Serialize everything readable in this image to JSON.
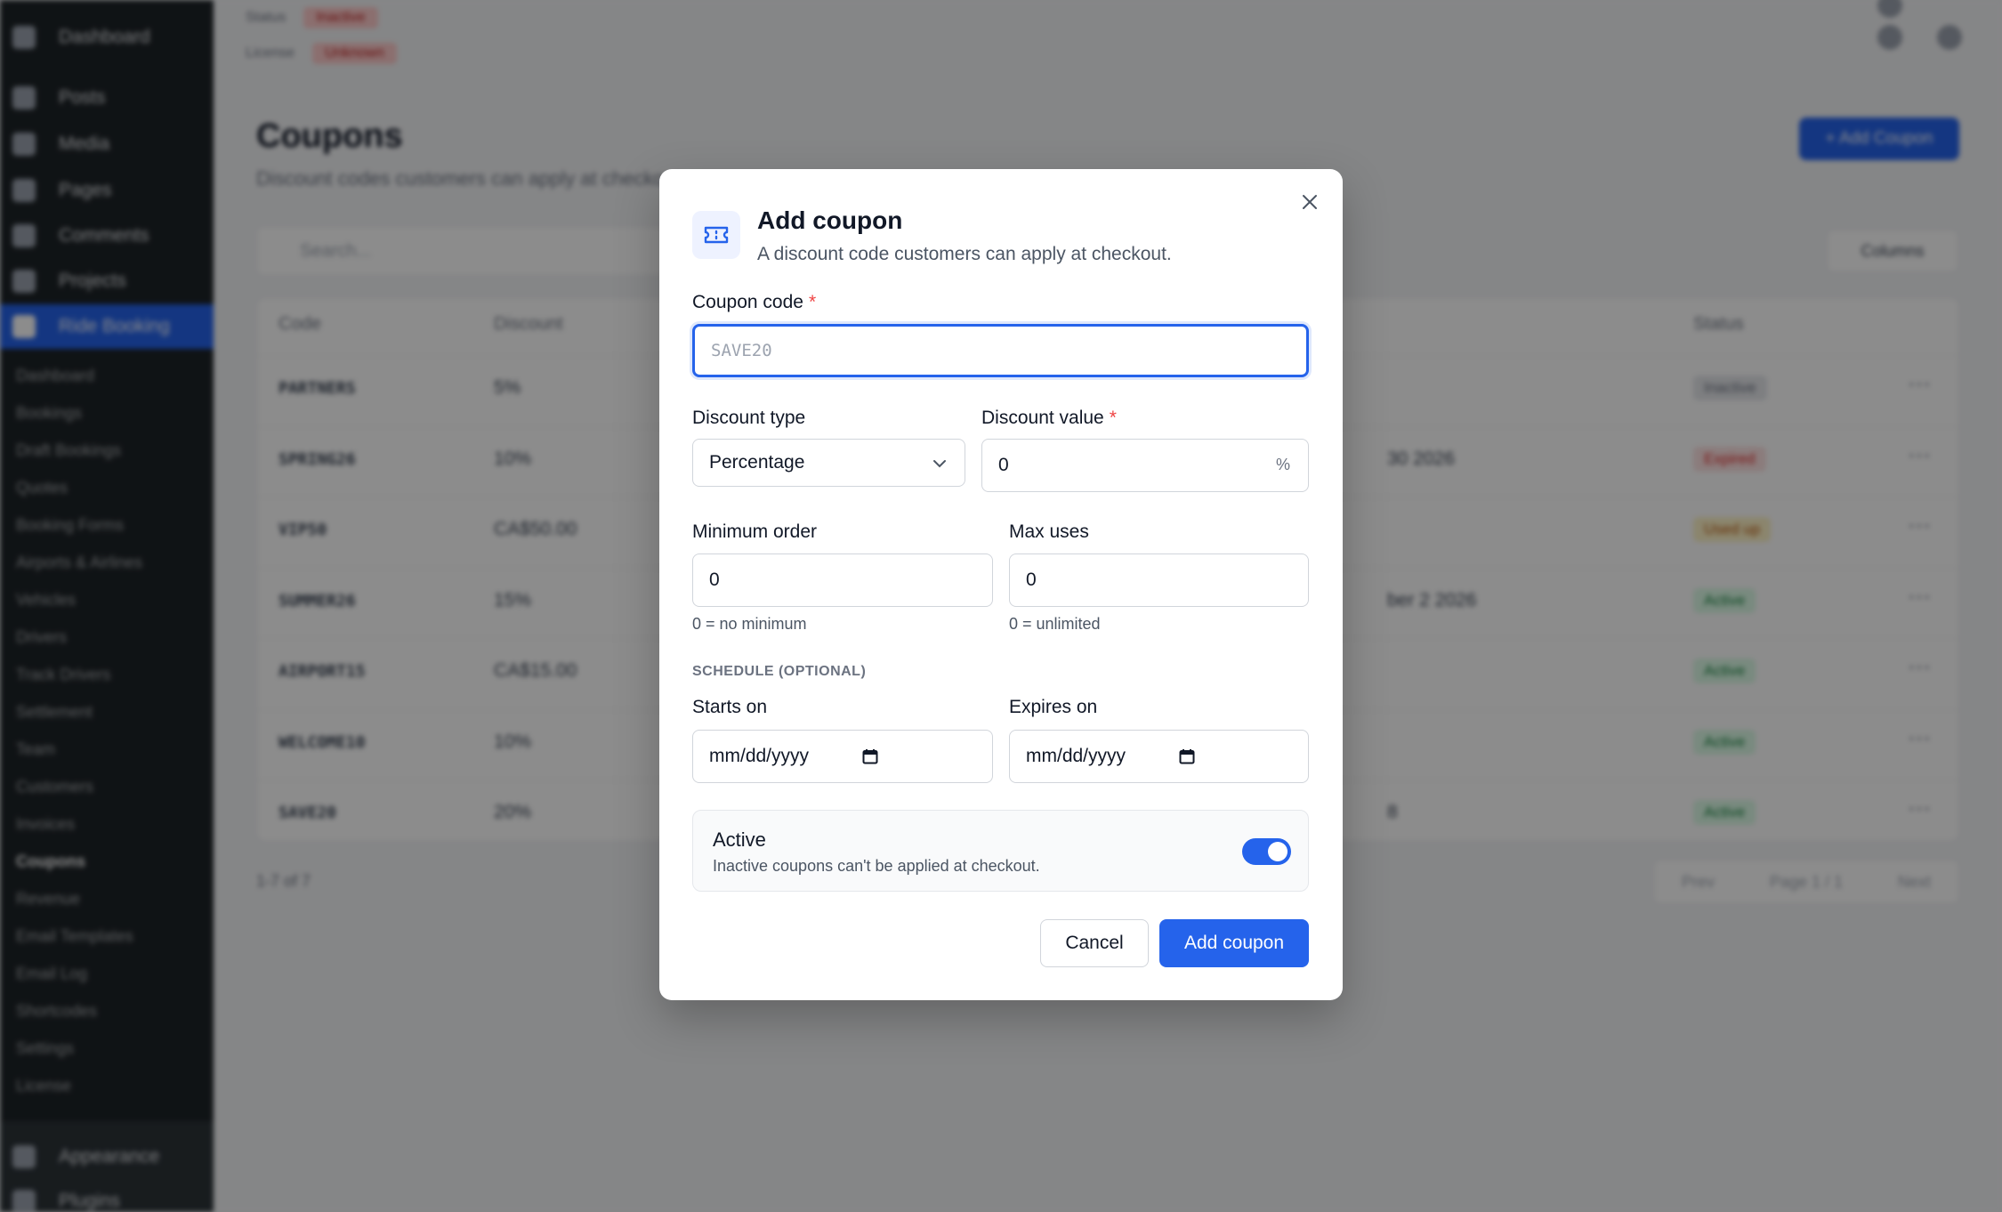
{
  "background": {
    "sidebar": {
      "top_items": [
        "Dashboard",
        "Posts",
        "Media",
        "Pages",
        "Comments",
        "Projects"
      ],
      "active_item": "Ride Booking",
      "sub_items": [
        "Dashboard",
        "Bookings",
        "Draft Bookings",
        "Quotes",
        "Booking Forms",
        "Airports & Airlines",
        "Vehicles",
        "Drivers",
        "Track Drivers",
        "Settlement",
        "Team",
        "Customers",
        "Invoices",
        "Coupons",
        "Revenue",
        "Email Templates",
        "Email Log",
        "Shortcodes",
        "Settings",
        "License"
      ],
      "current_sub": "Coupons",
      "bottom_items": [
        "Appearance",
        "Plugins"
      ]
    },
    "top_meta": [
      {
        "label": "Status",
        "value": "Inactive"
      },
      {
        "label": "License",
        "value": "Unknown"
      }
    ],
    "page_title": "Coupons",
    "page_subtitle": "Discount codes customers can apply at checkout.",
    "add_button": "+ Add Coupon",
    "search_placeholder": "Search...",
    "columns_button": "Columns",
    "table": {
      "headers": [
        "Code",
        "Discount",
        "Status"
      ],
      "rows": [
        {
          "code": "PARTNERS",
          "discount": "5%",
          "expires": "",
          "status": "Inactive",
          "status_color": "#e5e7eb",
          "status_text": "#6b7280"
        },
        {
          "code": "SPRING26",
          "discount": "10%",
          "expires": "30 2026",
          "status": "Expired",
          "status_color": "#fee2e2",
          "status_text": "#dc2626"
        },
        {
          "code": "VIP50",
          "discount": "CA$50.00",
          "expires": "",
          "status": "Used up",
          "status_color": "#fef3c7",
          "status_text": "#b45309"
        },
        {
          "code": "SUMMER26",
          "discount": "15%",
          "expires": "ber 2 2026",
          "status": "Active",
          "status_color": "#dcfce7",
          "status_text": "#15803d"
        },
        {
          "code": "AIRPORT15",
          "discount": "CA$15.00",
          "expires": "",
          "status": "Active",
          "status_color": "#dcfce7",
          "status_text": "#15803d"
        },
        {
          "code": "WELCOME10",
          "discount": "10%",
          "expires": "",
          "status": "Active",
          "status_color": "#dcfce7",
          "status_text": "#15803d"
        },
        {
          "code": "SAVE20",
          "discount": "20%",
          "expires": "8",
          "status": "Active",
          "status_color": "#dcfce7",
          "status_text": "#15803d"
        }
      ]
    },
    "footer_count": "1-7 of 7",
    "pager": {
      "prev": "Prev",
      "page": "Page 1 / 1",
      "next": "Next"
    }
  },
  "modal": {
    "title": "Add coupon",
    "description": "A discount code customers can apply at checkout.",
    "coupon_code": {
      "label": "Coupon code",
      "placeholder": "SAVE20",
      "required": "*"
    },
    "discount_type": {
      "label": "Discount type",
      "value": "Percentage"
    },
    "discount_value": {
      "label": "Discount value",
      "value": "0",
      "suffix": "%",
      "required": "*"
    },
    "minimum_order": {
      "label": "Minimum order",
      "value": "0",
      "hint": "0 = no minimum"
    },
    "max_uses": {
      "label": "Max uses",
      "value": "0",
      "hint": "0 = unlimited"
    },
    "schedule_heading": "SCHEDULE (OPTIONAL)",
    "starts_on": {
      "label": "Starts on",
      "placeholder": "mm/dd/yyyy"
    },
    "expires_on": {
      "label": "Expires on",
      "placeholder": "mm/dd/yyyy"
    },
    "active": {
      "title": "Active",
      "description": "Inactive coupons can't be applied at checkout.",
      "enabled": true
    },
    "cancel_label": "Cancel",
    "submit_label": "Add coupon"
  },
  "colors": {
    "accent": "#2563eb",
    "required": "#ef4444"
  }
}
